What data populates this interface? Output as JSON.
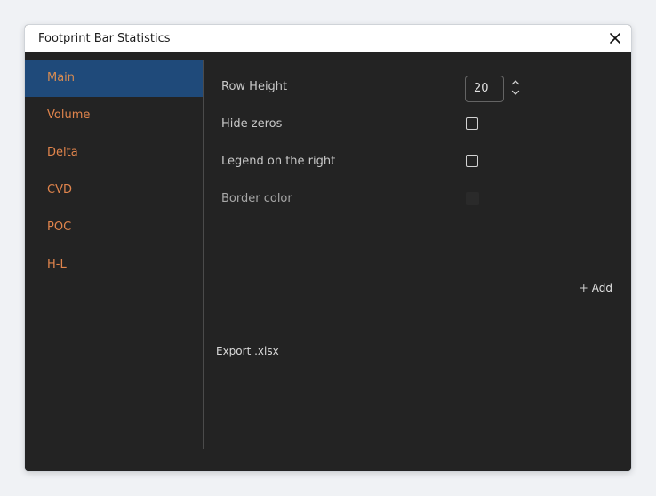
{
  "dialog": {
    "title": "Footprint Bar Statistics"
  },
  "sidebar": {
    "items": [
      {
        "label": "Main",
        "active": true
      },
      {
        "label": "Volume",
        "active": false
      },
      {
        "label": "Delta",
        "active": false
      },
      {
        "label": "CVD",
        "active": false
      },
      {
        "label": "POC",
        "active": false
      },
      {
        "label": "H-L",
        "active": false
      }
    ]
  },
  "settings": {
    "row_height_label": "Row Height",
    "row_height_value": "20",
    "hide_zeros_label": "Hide zeros",
    "hide_zeros_checked": false,
    "legend_right_label": "Legend on the right",
    "legend_right_checked": false,
    "border_color_label": "Border color",
    "border_color_value": "#2a2a2a"
  },
  "actions": {
    "add_label": "Add",
    "export_label": "Export .xlsx"
  },
  "icons": {
    "close": "close-icon",
    "stepper_up": "chevron-up-icon",
    "stepper_down": "chevron-down-icon",
    "add": "plus-icon"
  },
  "colors": {
    "dialog_bg": "#232323",
    "active_tab": "#1f4a7a",
    "tab_text": "#e0844c"
  }
}
